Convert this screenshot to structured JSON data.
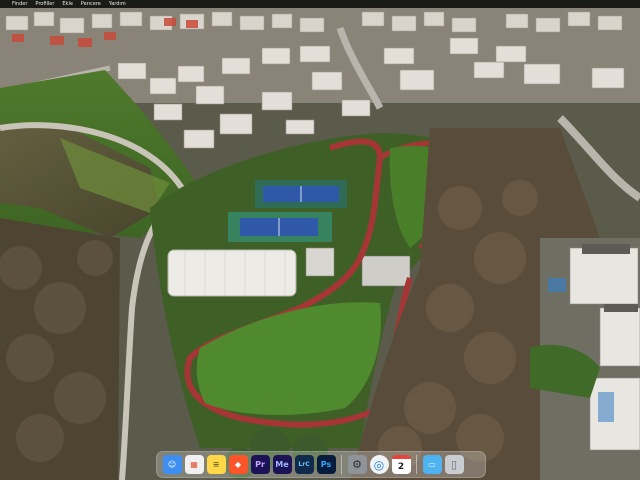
{
  "menubar": {
    "apple_glyph": "",
    "items": [
      "Finder",
      "Profiller",
      "Ekle",
      "Pencere",
      "Yardım"
    ]
  },
  "wallpaper": {
    "name": "aerial-park-tennis-courts"
  },
  "dock": {
    "apps": [
      {
        "name": "finder-icon",
        "glyph": "☺",
        "bg": "#3d8ef0",
        "fg": "#ffffff"
      },
      {
        "name": "launchpad-icon",
        "glyph": "▦",
        "bg": "#f0f0f0",
        "fg": "#e0522f"
      },
      {
        "name": "notes-icon",
        "glyph": "≡",
        "bg": "#ffd84a",
        "fg": "#7a6a2a"
      },
      {
        "name": "brave-icon",
        "glyph": "◆",
        "bg": "#fb542b",
        "fg": "#ffffff"
      },
      {
        "name": "premiere-icon",
        "glyph": "Pr",
        "bg": "#1c1256",
        "fg": "#c9a6ff"
      },
      {
        "name": "media-encoder-icon",
        "glyph": "Me",
        "bg": "#1c1256",
        "fg": "#9fb8ff"
      },
      {
        "name": "lightroom-classic-icon",
        "glyph": "LrC",
        "bg": "#0f2a4a",
        "fg": "#6fc3ff"
      },
      {
        "name": "photoshop-icon",
        "glyph": "Ps",
        "bg": "#071b3c",
        "fg": "#31a8ff"
      },
      {
        "name": "system-settings-icon",
        "glyph": "⚙",
        "bg": "#8f949b",
        "fg": "#2c2f33"
      },
      {
        "name": "safari-icon",
        "glyph": "◎",
        "bg": "#f0f4f8",
        "fg": "#1f7bd8"
      },
      {
        "name": "calendar-icon",
        "glyph": "2",
        "bg": "#ffffff",
        "fg": "#222222",
        "month": ""
      },
      {
        "name": "folder-icon",
        "glyph": "▭",
        "bg": "#4fb3f0",
        "fg": "#e6f4ff"
      },
      {
        "name": "trash-icon",
        "glyph": "▯",
        "bg": "#c9ccd0",
        "fg": "#6b6f75"
      }
    ]
  }
}
